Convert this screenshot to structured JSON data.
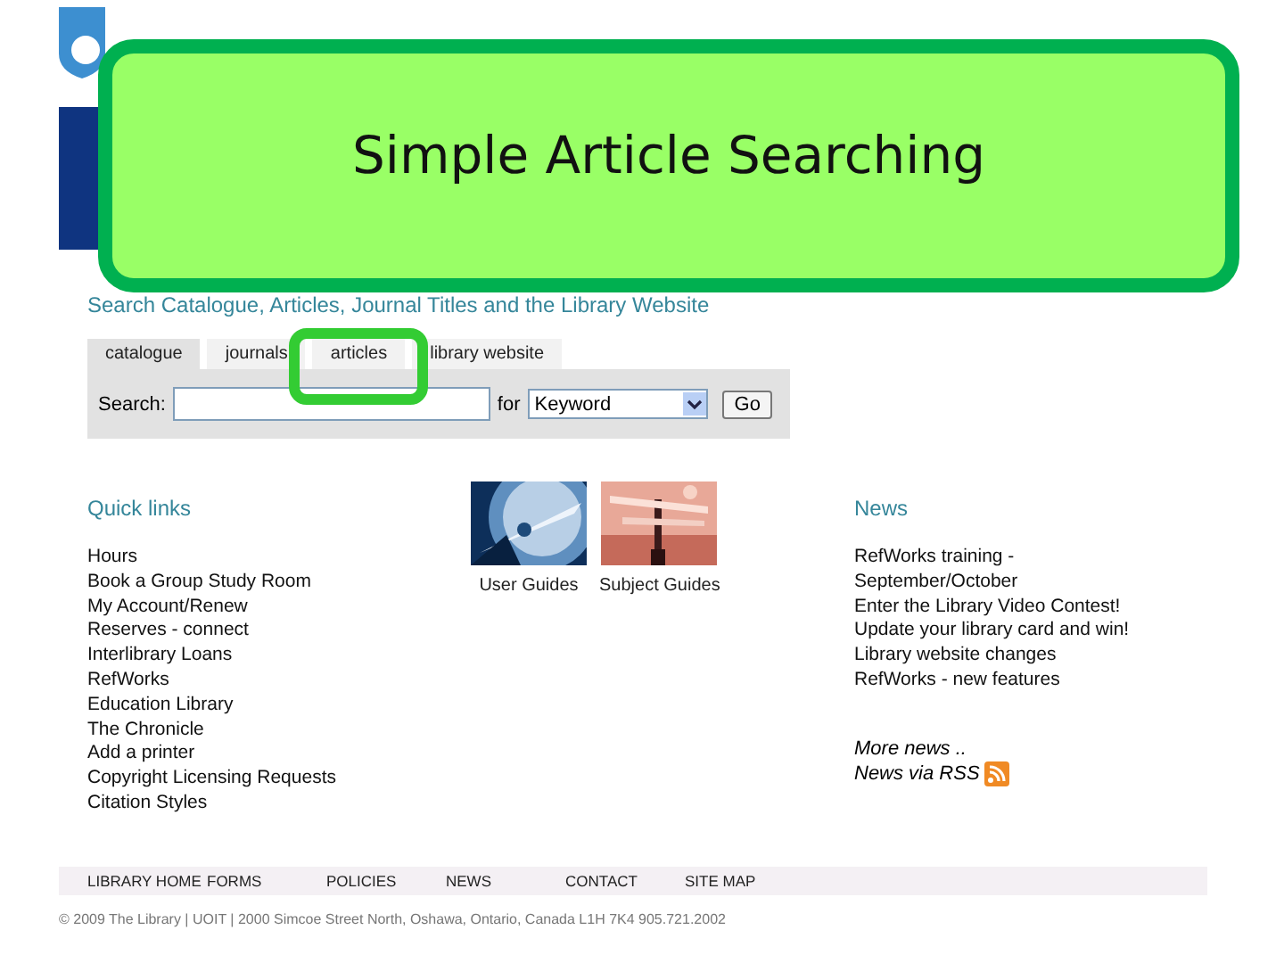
{
  "callout": {
    "title": "Simple Article Searching"
  },
  "search": {
    "heading": "Search Catalogue, Articles, Journal Titles and the Library Website",
    "tabs": [
      {
        "label": "catalogue",
        "selected": true
      },
      {
        "label": "journals",
        "selected": false
      },
      {
        "label": "articles",
        "selected": false,
        "highlighted": true
      },
      {
        "label": "library website",
        "selected": false
      }
    ],
    "label": "Search:",
    "connector": "for",
    "dropdown": "Keyword",
    "button": "Go"
  },
  "quick_links": {
    "heading": "Quick links",
    "items": [
      "Hours",
      "Book a Group Study Room",
      "My Account/Renew",
      "Reserves - connect",
      "Interlibrary Loans",
      "RefWorks",
      "Education Library",
      "The Chronicle",
      "Add a printer",
      "Copyright Licensing Requests",
      "Citation Styles"
    ]
  },
  "guides": [
    {
      "caption": "User Guides",
      "kind": "picture"
    },
    {
      "caption": "Subject Guides",
      "kind": "picture"
    }
  ],
  "news": {
    "heading": "News",
    "items": [
      "RefWorks training - September/October",
      "Enter the Library Video Contest!",
      "Update your library card and win!",
      "Library website changes",
      "RefWorks - new features"
    ],
    "more": "More news ..",
    "rss": "News via RSS"
  },
  "footer": {
    "links": [
      "LIBRARY HOME",
      "FORMS",
      "POLICIES",
      "NEWS",
      "CONTACT",
      "SITE MAP"
    ],
    "copyright": "© 2009 The Library | UOIT | 2000 Simcoe Street North, Oshawa, Ontario, Canada L1H 7K4  905.721.2002"
  }
}
